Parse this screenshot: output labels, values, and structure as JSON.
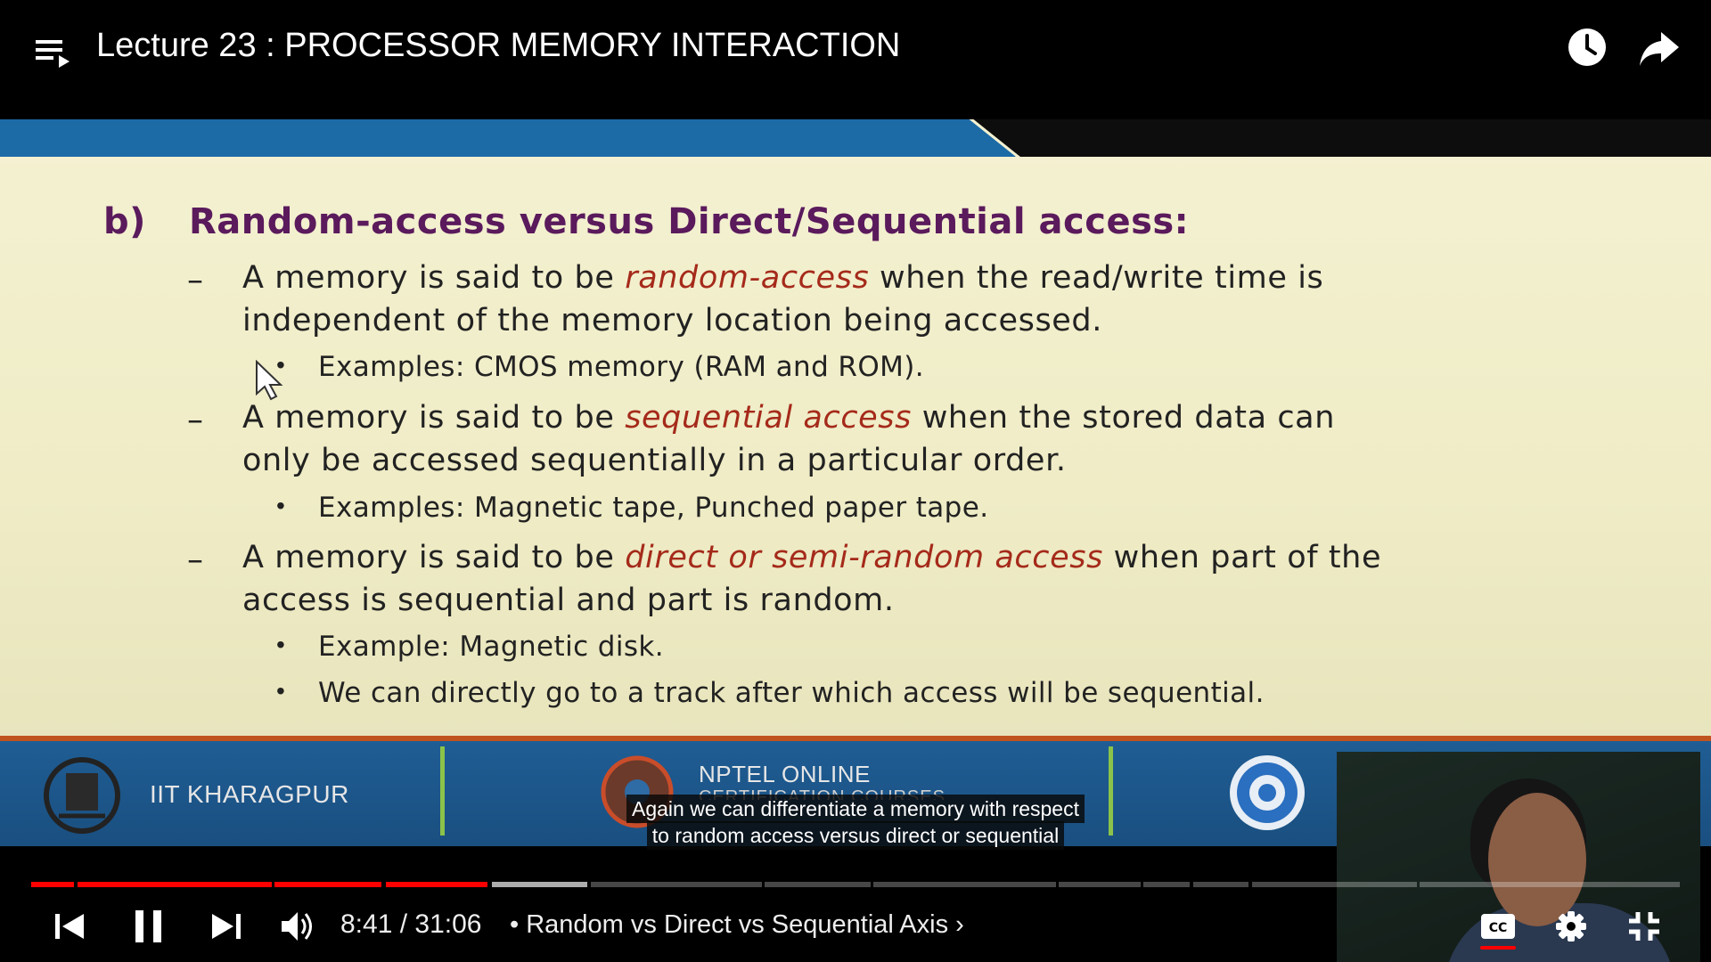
{
  "header": {
    "title": "Lecture 23 : PROCESSOR MEMORY INTERACTION"
  },
  "slide": {
    "heading_label": "b)",
    "heading": "Random-access versus Direct/Sequential access:",
    "points": [
      {
        "line1_pre": "A memory is said to be ",
        "line1_em": "random-access",
        "line1_post": " when the read/write time is",
        "line2": "independent of the memory location being accessed.",
        "examples": [
          "Examples: CMOS memory (RAM and ROM)."
        ]
      },
      {
        "line1_pre": "A memory is said to be ",
        "line1_em": "sequential access",
        "line1_post": " when the stored data can",
        "line2": "only be accessed sequentially in a particular order.",
        "examples": [
          "Examples: Magnetic tape, Punched paper tape."
        ]
      },
      {
        "line1_pre": "A memory is said to be ",
        "line1_em": "direct or semi-random access",
        "line1_post": " when part of the",
        "line2": "access is sequential and part is random.",
        "examples": [
          "Example: Magnetic disk.",
          "We can directly go to a track after which access will be sequential."
        ]
      }
    ],
    "footer": {
      "left_text": "IIT KHARAGPUR",
      "center_text": "NPTEL ONLINE",
      "center_subtext": "CERTIFICATION COURSES"
    }
  },
  "captions": {
    "line1": "Again we can differentiate a memory with respect",
    "line2": "to random access versus direct or sequential"
  },
  "player": {
    "time_current": "8:41",
    "time_separator": " / ",
    "time_total": "31:06",
    "chapter_prefix": " • ",
    "chapter": "Random vs Direct vs Sequential Axis",
    "chapter_chevron": "›",
    "progress": 0.279,
    "captions_enabled": true,
    "accent_color": "#ff0000"
  },
  "icons": {
    "playlist": "playlist-icon",
    "watch_later": "clock-icon",
    "share": "share-icon",
    "previous": "skip-previous-icon",
    "pause": "pause-icon",
    "next": "skip-next-icon",
    "volume": "volume-icon",
    "captions": "cc-icon",
    "settings": "gear-icon",
    "exit_fullscreen": "exit-fullscreen-icon"
  }
}
